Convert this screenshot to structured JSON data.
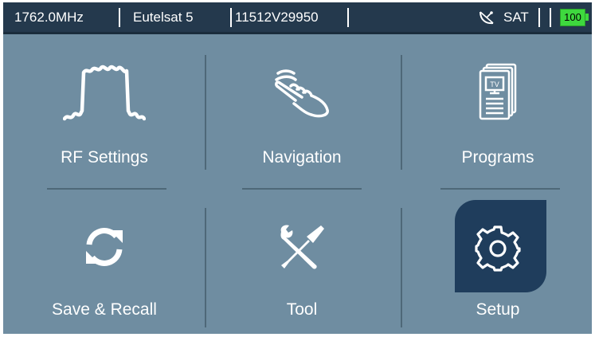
{
  "status_bar": {
    "frequency": "1762.0MHz",
    "satellite": "Eutelsat 5",
    "transponder": "11512V29950",
    "mode": "SAT",
    "battery": "100",
    "signal_icon": "satellite-dish-icon"
  },
  "menu": {
    "items": [
      {
        "label": "RF Settings",
        "icon": "rf-spectrum-icon"
      },
      {
        "label": "Navigation",
        "icon": "hand-pointer-icon"
      },
      {
        "label": "Programs",
        "icon": "tv-program-list-icon"
      },
      {
        "label": "Save & Recall",
        "icon": "refresh-arrows-icon"
      },
      {
        "label": "Tool",
        "icon": "wrench-screwdriver-icon"
      },
      {
        "label": "Setup",
        "icon": "gear-icon"
      }
    ],
    "selected": "Setup"
  },
  "colors": {
    "background": "#6f8da1",
    "status_bar": "#24394d",
    "selected_tile": "#1f3d5c",
    "battery": "#3ed83e"
  }
}
